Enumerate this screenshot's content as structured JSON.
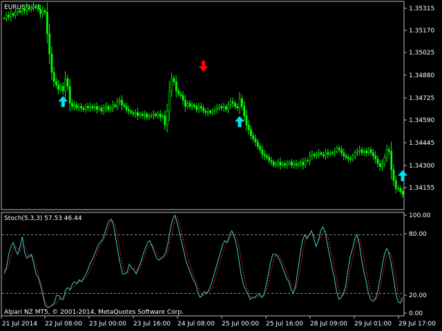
{
  "window": {
    "title": "EURUSD,H1"
  },
  "colors": {
    "background": "#000000",
    "frame": "#c0c0c0",
    "candle": "#00ff00",
    "buy_arrow": "#00e5ee",
    "sell_arrow": "#ff0000",
    "stoch_main": "#3fd0d0",
    "stoch_signal": "#ff2020",
    "level_line": "#c0c0c0"
  },
  "price_axis": {
    "ticks": [
      "1.35315",
      "1.35170",
      "1.35025",
      "1.34880",
      "1.34725",
      "1.34590",
      "1.34445",
      "1.34300",
      "1.34155"
    ]
  },
  "indicator": {
    "label": "Stoch(5,3,3) 57.53 46.44",
    "name": "Stoch(5,3,3)",
    "main_value": 57.53,
    "signal_value": 46.44,
    "axis_ticks": [
      "100.00",
      "80.00",
      "20.00",
      "0.00"
    ],
    "levels": [
      80,
      20
    ]
  },
  "copyright": "Alpari NZ MT5, © 2001-2014, MetaQuotes Software Corp.",
  "time_axis": {
    "ticks": [
      "21 Jul 2014",
      "22 Jul 08:00",
      "23 Jul 00:00",
      "23 Jul 16:00",
      "24 Jul 08:00",
      "25 Jul 00:00",
      "25 Jul 16:00",
      "28 Jul 09:00",
      "29 Jul 01:00",
      "29 Jul 17:00"
    ]
  },
  "chart_data": {
    "type": "candlestick",
    "symbol": "EURUSD",
    "timeframe": "H1",
    "price_range": [
      1.3409,
      1.3538
    ],
    "close": [
      1.3525,
      1.3527,
      1.3526,
      1.3528,
      1.3527,
      1.3529,
      1.353,
      1.3529,
      1.3531,
      1.353,
      1.3532,
      1.3531,
      1.3532,
      1.3533,
      1.3532,
      1.3531,
      1.3528,
      1.353,
      1.3529,
      1.3515,
      1.3502,
      1.349,
      1.3484,
      1.3482,
      1.3479,
      1.3481,
      1.3478,
      1.3486,
      1.3481,
      1.347,
      1.3468,
      1.3469,
      1.3467,
      1.3468,
      1.3467,
      1.3466,
      1.3468,
      1.3467,
      1.3468,
      1.3467,
      1.3468,
      1.3466,
      1.3467,
      1.3465,
      1.3467,
      1.3468,
      1.3466,
      1.3467,
      1.3469,
      1.3468,
      1.3471,
      1.3472,
      1.3469,
      1.3468,
      1.3466,
      1.3465,
      1.3464,
      1.3463,
      1.3464,
      1.3462,
      1.3463,
      1.3462,
      1.3463,
      1.3461,
      1.3462,
      1.3462,
      1.3463,
      1.3462,
      1.3463,
      1.3461,
      1.3462,
      1.3456,
      1.3465,
      1.3478,
      1.3486,
      1.3484,
      1.3478,
      1.3476,
      1.3475,
      1.3472,
      1.3468,
      1.347,
      1.3468,
      1.3469,
      1.3468,
      1.3466,
      1.3468,
      1.3467,
      1.3465,
      1.3464,
      1.3465,
      1.3464,
      1.3465,
      1.3466,
      1.3467,
      1.3468,
      1.3467,
      1.3468,
      1.3466,
      1.3469,
      1.3471,
      1.347,
      1.3468,
      1.3467,
      1.3473,
      1.3468,
      1.3462,
      1.3456,
      1.3453,
      1.3449,
      1.3447,
      1.3445,
      1.3442,
      1.344,
      1.3437,
      1.3436,
      1.3435,
      1.3433,
      1.3432,
      1.343,
      1.3431,
      1.3432,
      1.343,
      1.3431,
      1.343,
      1.3431,
      1.3432,
      1.343,
      1.3431,
      1.343,
      1.3431,
      1.3432,
      1.343,
      1.3433,
      1.3433,
      1.3436,
      1.3437,
      1.3436,
      1.3437,
      1.3438,
      1.3437,
      1.3436,
      1.3438,
      1.3437,
      1.3438,
      1.3438,
      1.3439,
      1.3441,
      1.344,
      1.3438,
      1.3436,
      1.3435,
      1.3434,
      1.3434,
      1.3436,
      1.3438,
      1.3439,
      1.344,
      1.3438,
      1.3439,
      1.3438,
      1.344,
      1.3438,
      1.3436,
      1.3434,
      1.3431,
      1.3429,
      1.3431,
      1.3435,
      1.344,
      1.3439,
      1.3427,
      1.342,
      1.3415,
      1.3415,
      1.3413,
      1.3411
    ],
    "indicator_series": [
      {
        "name": "Stoch(5,3,3)",
        "main": [
          40,
          46,
          60,
          68,
          72,
          64,
          60,
          68,
          78,
          62,
          56,
          58,
          60,
          50,
          40,
          36,
          28,
          18,
          8,
          6,
          6,
          8,
          10,
          18,
          18,
          14,
          14,
          24,
          26,
          24,
          30,
          32,
          30,
          34,
          32,
          36,
          40,
          46,
          52,
          56,
          62,
          68,
          72,
          74,
          80,
          88,
          94,
          96,
          90,
          76,
          62,
          50,
          40,
          40,
          42,
          50,
          46,
          44,
          40,
          46,
          52,
          60,
          66,
          72,
          74,
          68,
          62,
          56,
          54,
          56,
          58,
          62,
          72,
          86,
          96,
          100,
          92,
          82,
          72,
          62,
          52,
          46,
          40,
          34,
          30,
          22,
          16,
          18,
          22,
          20,
          24,
          30,
          38,
          46,
          54,
          62,
          70,
          74,
          72,
          80,
          84,
          78,
          70,
          56,
          40,
          30,
          24,
          20,
          14,
          16,
          16,
          18,
          20,
          16,
          18,
          28,
          40,
          52,
          60,
          60,
          58,
          54,
          48,
          42,
          36,
          32,
          24,
          20,
          28,
          44,
          60,
          74,
          80,
          76,
          80,
          84,
          76,
          68,
          74,
          84,
          88,
          82,
          70,
          58,
          46,
          36,
          22,
          14,
          16,
          20,
          28,
          44,
          58,
          66,
          76,
          80,
          70,
          54,
          42,
          32,
          20,
          14,
          12,
          14,
          22,
          34,
          48,
          60,
          66,
          62,
          50,
          36,
          20,
          12,
          10,
          16
        ],
        "signal": [
          44,
          44,
          48,
          58,
          66,
          68,
          66,
          64,
          70,
          68,
          62,
          58,
          58,
          56,
          48,
          40,
          32,
          24,
          12,
          8,
          6,
          8,
          8,
          10,
          14,
          16,
          16,
          18,
          22,
          24,
          26,
          28,
          30,
          32,
          32,
          34,
          36,
          40,
          46,
          50,
          56,
          62,
          68,
          72,
          76,
          82,
          88,
          94,
          94,
          88,
          76,
          62,
          50,
          42,
          40,
          44,
          46,
          46,
          44,
          44,
          48,
          54,
          60,
          66,
          70,
          70,
          66,
          62,
          58,
          56,
          56,
          58,
          64,
          74,
          86,
          96,
          98,
          92,
          82,
          72,
          62,
          54,
          46,
          40,
          34,
          28,
          22,
          18,
          18,
          20,
          22,
          24,
          30,
          38,
          46,
          54,
          62,
          68,
          72,
          76,
          80,
          82,
          78,
          70,
          56,
          42,
          32,
          24,
          18,
          16,
          15,
          16,
          18,
          18,
          18,
          22,
          30,
          42,
          52,
          58,
          60,
          58,
          54,
          48,
          42,
          36,
          30,
          24,
          24,
          32,
          44,
          60,
          72,
          78,
          80,
          80,
          80,
          76,
          74,
          78,
          82,
          84,
          80,
          70,
          58,
          46,
          34,
          24,
          18,
          18,
          22,
          30,
          44,
          56,
          66,
          74,
          76,
          70,
          58,
          44,
          32,
          22,
          16,
          14,
          16,
          24,
          36,
          48,
          58,
          62,
          60,
          50,
          36,
          22,
          14,
          12
        ]
      }
    ],
    "signals": [
      {
        "type": "buy",
        "bar": 26,
        "price": 1.3481
      },
      {
        "type": "sell",
        "bar": 88,
        "price": 1.3486
      },
      {
        "type": "buy",
        "bar": 104,
        "price": 1.3468
      },
      {
        "type": "buy",
        "bar": 176,
        "price": 1.3433
      }
    ]
  }
}
